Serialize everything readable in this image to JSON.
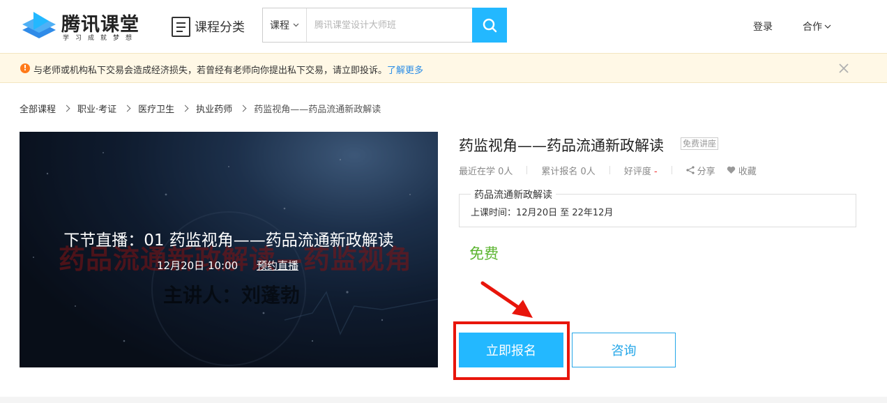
{
  "header": {
    "logo_title": "腾讯课堂",
    "logo_subtitle": "学习成就梦想",
    "category_label": "课程分类",
    "search": {
      "type_label": "课程",
      "placeholder": "腾讯课堂设计大师班"
    },
    "login_label": "登录",
    "cooperate_label": "合作"
  },
  "notice": {
    "text": "与老师或机构私下交易会造成经济损失，若曾经有老师向你提出私下交易，请立即投诉。",
    "link_label": "了解更多"
  },
  "breadcrumb": {
    "items": [
      "全部课程",
      "职业·考证",
      "医疗卫生",
      "执业药师"
    ],
    "current": "药监视角——药品流通新政解读"
  },
  "hero": {
    "bg_title": "药品流通新政解读—药监视角",
    "bg_speaker": "主讲人：刘蓬勃",
    "live_title": "下节直播：01 药监视角——药品流通新政解读",
    "live_time": "12月20日 10:00",
    "reserve_label": "预约直播"
  },
  "course": {
    "title": "药监视角——药品流通新政解读",
    "tag": "免费讲座",
    "recent_label": "最近在学 0人",
    "enrolled_label": "累计报名 0人",
    "rating_label": "好评度",
    "rating_value": "-",
    "share_label": "分享",
    "favorite_label": "收藏",
    "session_name": "药品流通新政解读",
    "session_time": "上课时间：12月20日 至 22年12月",
    "price": "免费",
    "signup_label": "立即报名",
    "consult_label": "咨询"
  },
  "colors": {
    "accent": "#23b8ff",
    "price_green": "#5cb531",
    "highlight_red": "#e8150b",
    "notice_bg": "#fff8e6",
    "link_blue": "#2a8ce6"
  }
}
